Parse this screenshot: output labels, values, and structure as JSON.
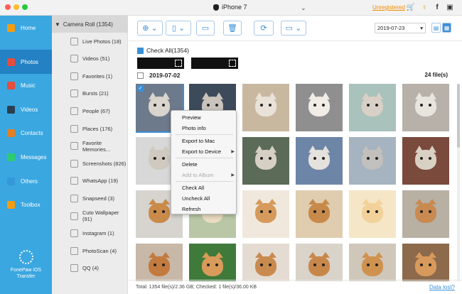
{
  "titlebar": {
    "device_name": "iPhone 7",
    "unregistered": "Unregistered"
  },
  "nav": [
    {
      "label": "Home",
      "icon": "home-icon",
      "color": "#f39c12"
    },
    {
      "label": "Photos",
      "icon": "photos-icon",
      "color": "#e74c3c"
    },
    {
      "label": "Music",
      "icon": "music-icon",
      "color": "#e74c3c"
    },
    {
      "label": "Videos",
      "icon": "videos-icon",
      "color": "#2c3e50"
    },
    {
      "label": "Contacts",
      "icon": "contacts-icon",
      "color": "#e67e22"
    },
    {
      "label": "Messages",
      "icon": "messages-icon",
      "color": "#2ecc71"
    },
    {
      "label": "Others",
      "icon": "others-icon",
      "color": "#3498db"
    },
    {
      "label": "Toolbox",
      "icon": "toolbox-icon",
      "color": "#f39c12"
    }
  ],
  "brand": {
    "line1": "FonePaw iOS",
    "line2": "Transfer"
  },
  "albums": {
    "header": "Camera Roll (1354)",
    "items": [
      "Live Photos (18)",
      "Videos (51)",
      "Favorites (1)",
      "Bursts (21)",
      "People (67)",
      "Places (176)",
      "Favorite Memories...",
      "Screenshots (826)",
      "WhatsApp (19)",
      "Snapseed (3)",
      "Cuto Wallpaper (91)",
      "Instagram (1)",
      "PhotoScan (4)",
      "QQ (4)"
    ]
  },
  "toolbar": {
    "date": "2019-07-23"
  },
  "content": {
    "check_all": "Check All(1354)",
    "group_date": "2019-07-02",
    "group_count": "24 file(s)"
  },
  "context_menu": {
    "items": [
      {
        "label": "Preview",
        "enabled": true
      },
      {
        "label": "Photo info",
        "enabled": true
      },
      {
        "label": "Export to Mac",
        "enabled": true
      },
      {
        "label": "Export to Device",
        "enabled": true,
        "submenu": true
      },
      {
        "label": "Delete",
        "enabled": true
      },
      {
        "label": "Add to Album",
        "enabled": false,
        "submenu": true
      },
      {
        "label": "Check All",
        "enabled": true
      },
      {
        "label": "Uncheck All",
        "enabled": true
      },
      {
        "label": "Refresh",
        "enabled": true
      }
    ]
  },
  "status": {
    "text": "Total: 1354 file(s)/2.36 GB; Checked: 1 file(s)/36.00 KB",
    "data_lost": "Data lost?"
  },
  "thumbs": [
    {
      "bg": "#6d7a8c",
      "fur": "#d9d4cc",
      "subject": "cat",
      "selected": true
    },
    {
      "bg": "#3c4a5a",
      "fur": "#c9c3bb",
      "subject": "cat",
      "selected": false
    },
    {
      "bg": "#c9b8a0",
      "fur": "#e9e2d8",
      "subject": "cat",
      "selected": false
    },
    {
      "bg": "#8f8f8f",
      "fur": "#f0ece6",
      "subject": "cat",
      "selected": false
    },
    {
      "bg": "#a9c2bb",
      "fur": "#d8d0c6",
      "subject": "cat",
      "selected": false
    },
    {
      "bg": "#b7b1a9",
      "fur": "#e8e4de",
      "subject": "cat",
      "selected": false
    },
    {
      "bg": "#d8d8d8",
      "fur": "#cfc9c0",
      "subject": "cat",
      "selected": false
    },
    {
      "bg": "#2f3b4a",
      "fur": "#bdb6ae",
      "subject": "cat",
      "selected": false
    },
    {
      "bg": "#5c6b58",
      "fur": "#d6cfc4",
      "subject": "cat",
      "selected": false
    },
    {
      "bg": "#6d86a8",
      "fur": "#e5e1dc",
      "subject": "cat",
      "selected": false
    },
    {
      "bg": "#a6b3c0",
      "fur": "#c2c0bd",
      "subject": "cat",
      "selected": false
    },
    {
      "bg": "#7a4a3c",
      "fur": "#d9d0c4",
      "subject": "cat",
      "selected": false
    },
    {
      "bg": "#d7d4cf",
      "fur": "#c98a4a",
      "subject": "dog",
      "selected": false
    },
    {
      "bg": "#b9c7a6",
      "fur": "#eadcc2",
      "subject": "dog",
      "selected": false
    },
    {
      "bg": "#f0e8dc",
      "fur": "#d59a5c",
      "subject": "dog",
      "selected": false
    },
    {
      "bg": "#e0cdb0",
      "fur": "#c88a4a",
      "subject": "dog",
      "selected": false
    },
    {
      "bg": "#f5e6c8",
      "fur": "#f2d29a",
      "subject": "dog",
      "selected": false
    },
    {
      "bg": "#b9b0a4",
      "fur": "#c98a52",
      "subject": "dog",
      "selected": false
    },
    {
      "bg": "#c8b8a8",
      "fur": "#c27a3e",
      "subject": "dog",
      "selected": false
    },
    {
      "bg": "#3f7a3a",
      "fur": "#d99a5a",
      "subject": "dog",
      "selected": false
    },
    {
      "bg": "#e4dcd2",
      "fur": "#c98a50",
      "subject": "dog",
      "selected": false
    },
    {
      "bg": "#d9d3ca",
      "fur": "#c8874a",
      "subject": "dog",
      "selected": false
    },
    {
      "bg": "#d0c7bb",
      "fur": "#cf924f",
      "subject": "dog",
      "selected": false
    },
    {
      "bg": "#8d6a4c",
      "fur": "#d89a5c",
      "subject": "dog",
      "selected": false
    }
  ]
}
